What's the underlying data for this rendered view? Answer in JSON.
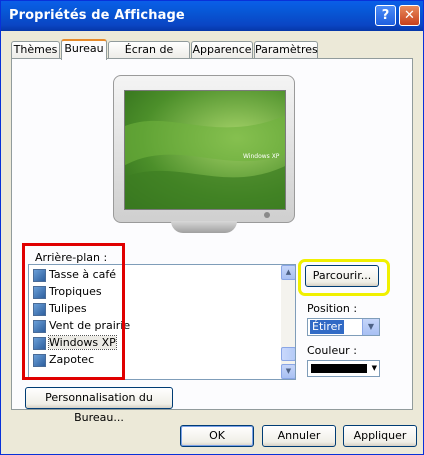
{
  "window": {
    "title": "Propriétés de Affichage",
    "help_label": "?",
    "close_label": "✕"
  },
  "tabs": [
    {
      "label": "Thèmes"
    },
    {
      "label": "Bureau"
    },
    {
      "label": "Écran de veille"
    },
    {
      "label": "Apparence"
    },
    {
      "label": "Paramètres"
    }
  ],
  "active_tab": "Bureau",
  "preview": {
    "logo_text": "Windows XP"
  },
  "background": {
    "label": "Arrière-plan :",
    "items": [
      {
        "label": "Tasse à café",
        "icon": "image-file-icon"
      },
      {
        "label": "Tropiques",
        "icon": "bitmap-file-icon"
      },
      {
        "label": "Tulipes",
        "icon": "bitmap-file-icon"
      },
      {
        "label": "Vent de prairie",
        "icon": "image-file-icon"
      },
      {
        "label": "Windows XP",
        "icon": "bitmap-file-icon",
        "selected": true
      },
      {
        "label": "Zapotec",
        "icon": "image-file-icon"
      }
    ]
  },
  "browse_button": "Parcourir...",
  "position": {
    "label": "Position :",
    "value": "Étirer"
  },
  "color": {
    "label": "Couleur :",
    "value": "#000000"
  },
  "customize_button": "Personnalisation du Bureau...",
  "footer": {
    "ok": "OK",
    "cancel": "Annuler",
    "apply": "Appliquer"
  },
  "highlights": {
    "red": "#e00000",
    "yellow": "#f0f000"
  }
}
